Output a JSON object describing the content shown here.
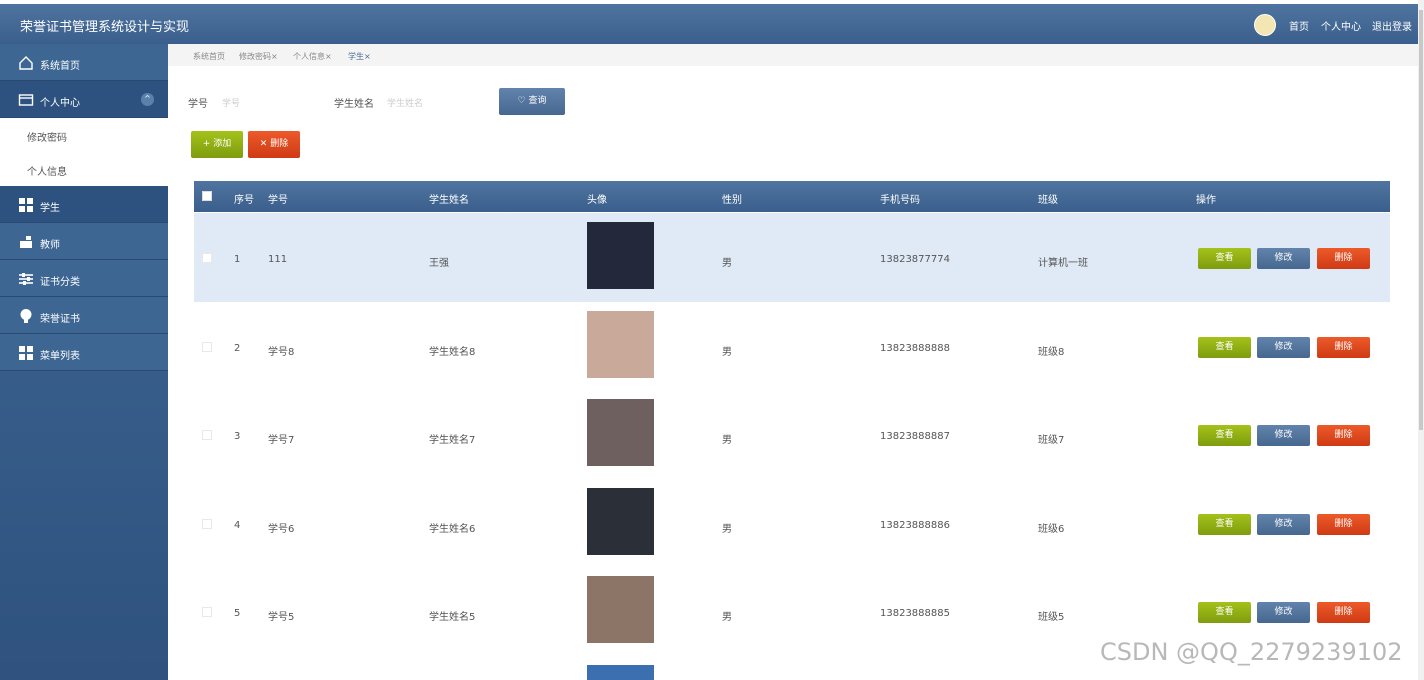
{
  "app": {
    "title": "荣誉证书管理系统设计与实现"
  },
  "topnav": {
    "home": "首页",
    "profile": "个人中心",
    "logout": "退出登录"
  },
  "sidebar": {
    "items": [
      {
        "label": "系统首页"
      },
      {
        "label": "个人中心",
        "subitems": [
          "修改密码",
          "个人信息"
        ]
      },
      {
        "label": "学生"
      },
      {
        "label": "教师"
      },
      {
        "label": "证书分类"
      },
      {
        "label": "荣誉证书"
      },
      {
        "label": "菜单列表"
      }
    ]
  },
  "breadcrumbs": [
    "系统首页",
    "修改密码×",
    "个人信息×",
    "学生×"
  ],
  "search": {
    "id_label": "学号",
    "id_placeholder": "学号",
    "name_label": "学生姓名",
    "name_placeholder": "学生姓名",
    "query_button": "♡ 查询"
  },
  "actions": {
    "add": "+ 添加",
    "delete": "✕ 删除"
  },
  "table": {
    "columns": [
      "序号",
      "学号",
      "学生姓名",
      "头像",
      "性别",
      "手机号码",
      "班级",
      "操作"
    ],
    "row_actions": {
      "view": "查看",
      "edit": "修改",
      "delete": "删除"
    },
    "rows": [
      {
        "index": "1",
        "id": "111",
        "name": "王强",
        "gender": "男",
        "phone": "13823877774",
        "class": "计算机一班",
        "avatar_color": "#23283a"
      },
      {
        "index": "2",
        "id": "学号8",
        "name": "学生姓名8",
        "gender": "男",
        "phone": "13823888888",
        "class": "班级8",
        "avatar_color": "#c9a99a"
      },
      {
        "index": "3",
        "id": "学号7",
        "name": "学生姓名7",
        "gender": "男",
        "phone": "13823888887",
        "class": "班级7",
        "avatar_color": "#6f6060"
      },
      {
        "index": "4",
        "id": "学号6",
        "name": "学生姓名6",
        "gender": "男",
        "phone": "13823888886",
        "class": "班级6",
        "avatar_color": "#2b2f38"
      },
      {
        "index": "5",
        "id": "学号5",
        "name": "学生姓名5",
        "gender": "男",
        "phone": "13823888885",
        "class": "班级5",
        "avatar_color": "#8c7466"
      }
    ]
  },
  "watermark": "CSDN @QQ_2279239102",
  "colors": {
    "header": "#3b5f8c",
    "view": "#8fb015",
    "edit": "#526f96",
    "delete": "#e04a20"
  }
}
